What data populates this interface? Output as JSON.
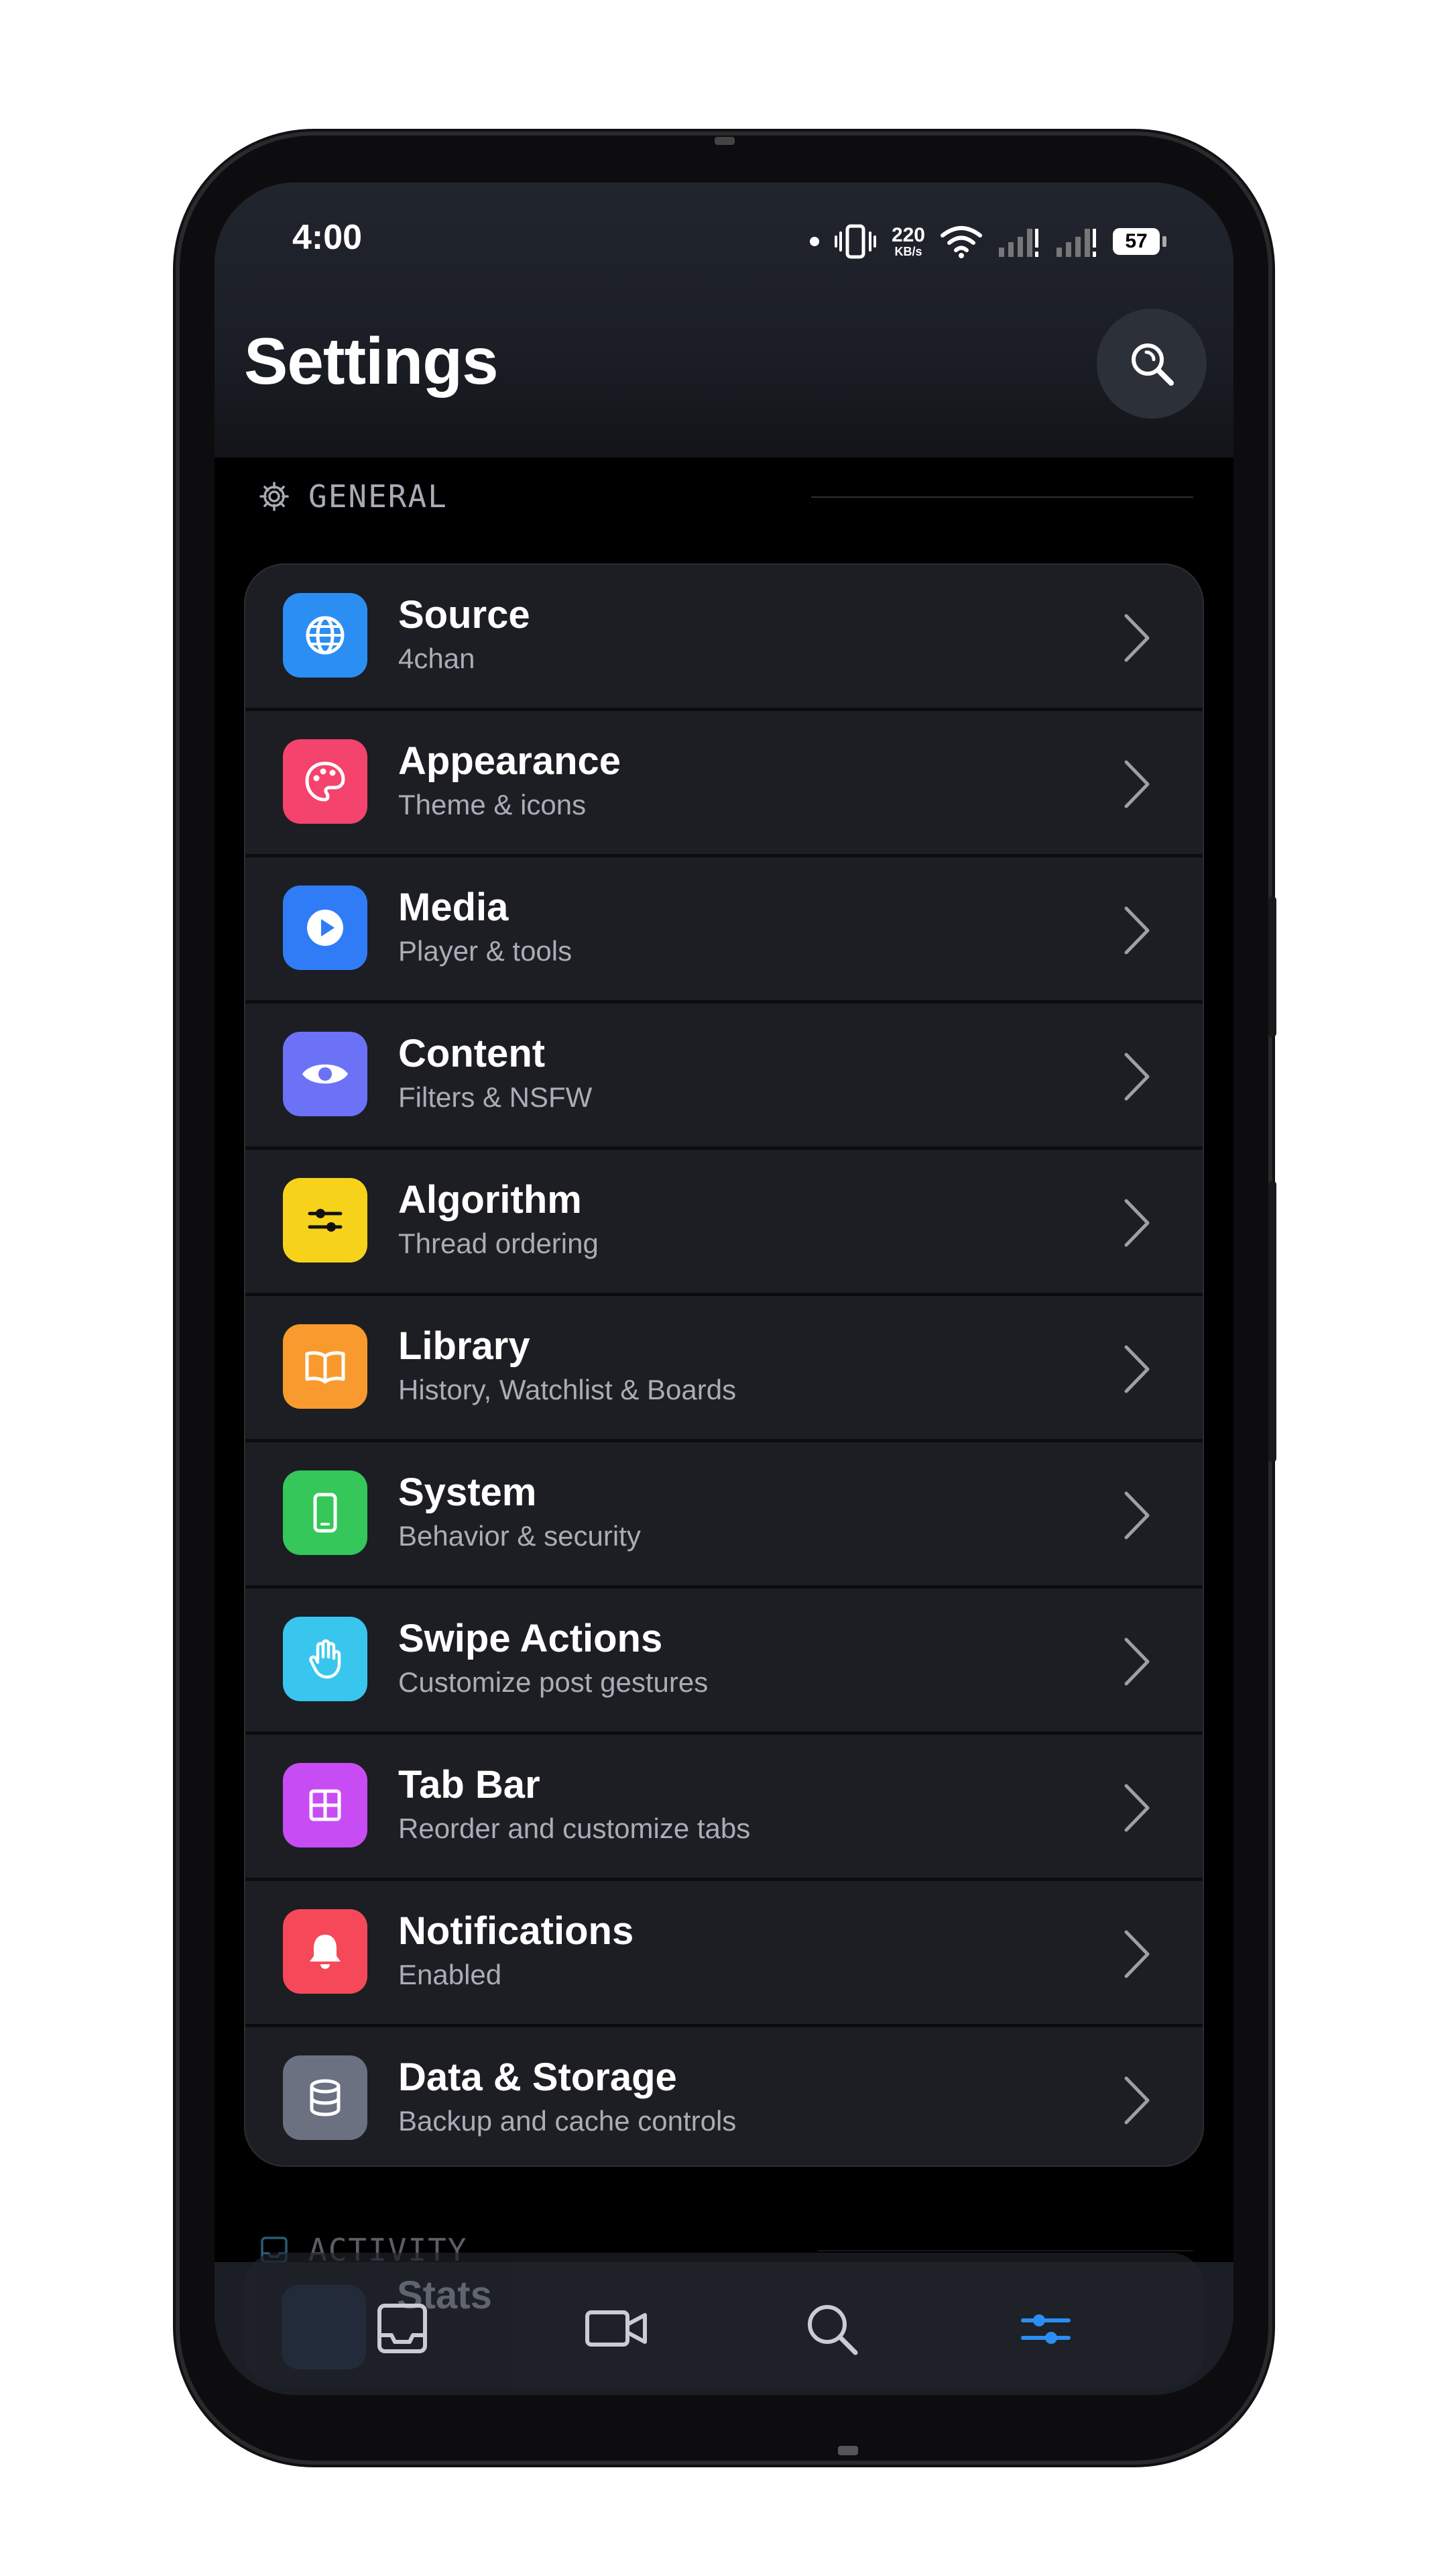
{
  "status_bar": {
    "time": "4:00",
    "net_speed_value": "220",
    "net_speed_unit": "KB/s",
    "battery": "57"
  },
  "header": {
    "title": "Settings",
    "search_icon": "search-icon"
  },
  "sections": {
    "general": {
      "label": "GENERAL",
      "icon": "gear-icon"
    },
    "activity": {
      "label": "ACTIVITY",
      "icon": "inbox-icon",
      "first_item": "Stats"
    }
  },
  "settings_items": [
    {
      "title": "Source",
      "subtitle": "4chan",
      "icon": "globe-icon",
      "color": "#2b8ef3"
    },
    {
      "title": "Appearance",
      "subtitle": "Theme & icons",
      "icon": "palette-icon",
      "color": "#f4436c"
    },
    {
      "title": "Media",
      "subtitle": "Player & tools",
      "icon": "play-icon",
      "color": "#2f7cf6"
    },
    {
      "title": "Content",
      "subtitle": "Filters & NSFW",
      "icon": "eye-icon",
      "color": "#6c72f5"
    },
    {
      "title": "Algorithm",
      "subtitle": "Thread ordering",
      "icon": "sliders-icon",
      "color": "#f7d21b"
    },
    {
      "title": "Library",
      "subtitle": "History, Watchlist & Boards",
      "icon": "book-icon",
      "color": "#f89a2e"
    },
    {
      "title": "System",
      "subtitle": "Behavior & security",
      "icon": "phone-icon",
      "color": "#35c759"
    },
    {
      "title": "Swipe Actions",
      "subtitle": "Customize post gestures",
      "icon": "hand-icon",
      "color": "#39c6ee"
    },
    {
      "title": "Tab Bar",
      "subtitle": "Reorder and customize tabs",
      "icon": "grid-icon",
      "color": "#c84cf4"
    },
    {
      "title": "Notifications",
      "subtitle": "Enabled",
      "icon": "bell-icon",
      "color": "#f5495a"
    },
    {
      "title": "Data & Storage",
      "subtitle": "Backup and cache controls",
      "icon": "database-icon",
      "color": "#6b7180"
    }
  ],
  "tab_bar": {
    "tabs": [
      {
        "icon": "inbox-icon",
        "active": false
      },
      {
        "icon": "video-icon",
        "active": false
      },
      {
        "icon": "search-icon",
        "active": false
      },
      {
        "icon": "sliders-icon",
        "active": true
      }
    ],
    "active_color": "#2b8ef3",
    "inactive_color": "#c9ccd2"
  }
}
